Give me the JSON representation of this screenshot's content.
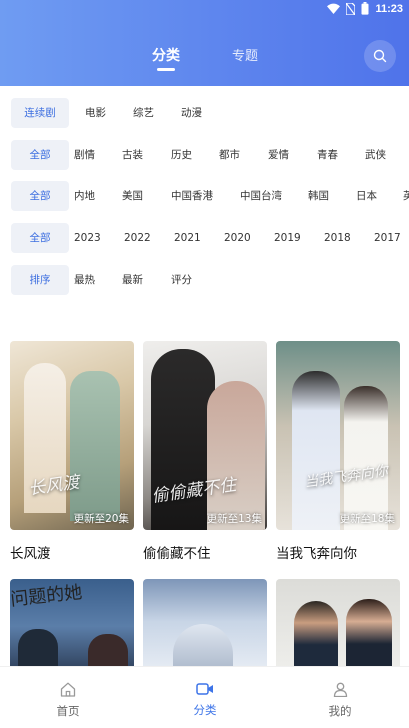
{
  "status_bar": {
    "time": "11:23"
  },
  "top_tabs": [
    {
      "label": "分类",
      "active": true
    },
    {
      "label": "专题",
      "active": false
    }
  ],
  "filters": {
    "type": [
      "连续剧",
      "电影",
      "综艺",
      "动漫"
    ],
    "genre": [
      "全部",
      "剧情",
      "古装",
      "历史",
      "都市",
      "爱情",
      "青春",
      "武侠"
    ],
    "region": [
      "全部",
      "内地",
      "美国",
      "中国香港",
      "中国台湾",
      "韩国",
      "日本",
      "英"
    ],
    "year": [
      "全部",
      "2023",
      "2022",
      "2021",
      "2020",
      "2019",
      "2018",
      "2017"
    ],
    "sort": [
      "排序",
      "最热",
      "最新",
      "评分"
    ]
  },
  "cards": [
    {
      "title": "长风渡",
      "badge": "更新至20集",
      "art_text": "长风渡"
    },
    {
      "title": "偷偷藏不住",
      "badge": "更新至13集",
      "art_text": "偷偷藏不住"
    },
    {
      "title": "当我飞奔向你",
      "badge": "更新至18集",
      "art_text": "当我飞奔向你"
    }
  ],
  "cards_row2": [
    {
      "art_text": "问题的她"
    },
    {
      "art_text": ""
    },
    {
      "art_text": ""
    }
  ],
  "bottom_nav": [
    {
      "label": "首页",
      "icon": "home-icon",
      "active": false
    },
    {
      "label": "分类",
      "icon": "video-icon",
      "active": true
    },
    {
      "label": "我的",
      "icon": "user-icon",
      "active": false
    }
  ],
  "colors": {
    "accent": "#3d74e8",
    "header_start": "#6f9cf2",
    "header_end": "#4f73ea",
    "chip_bg": "#eef1f7"
  }
}
